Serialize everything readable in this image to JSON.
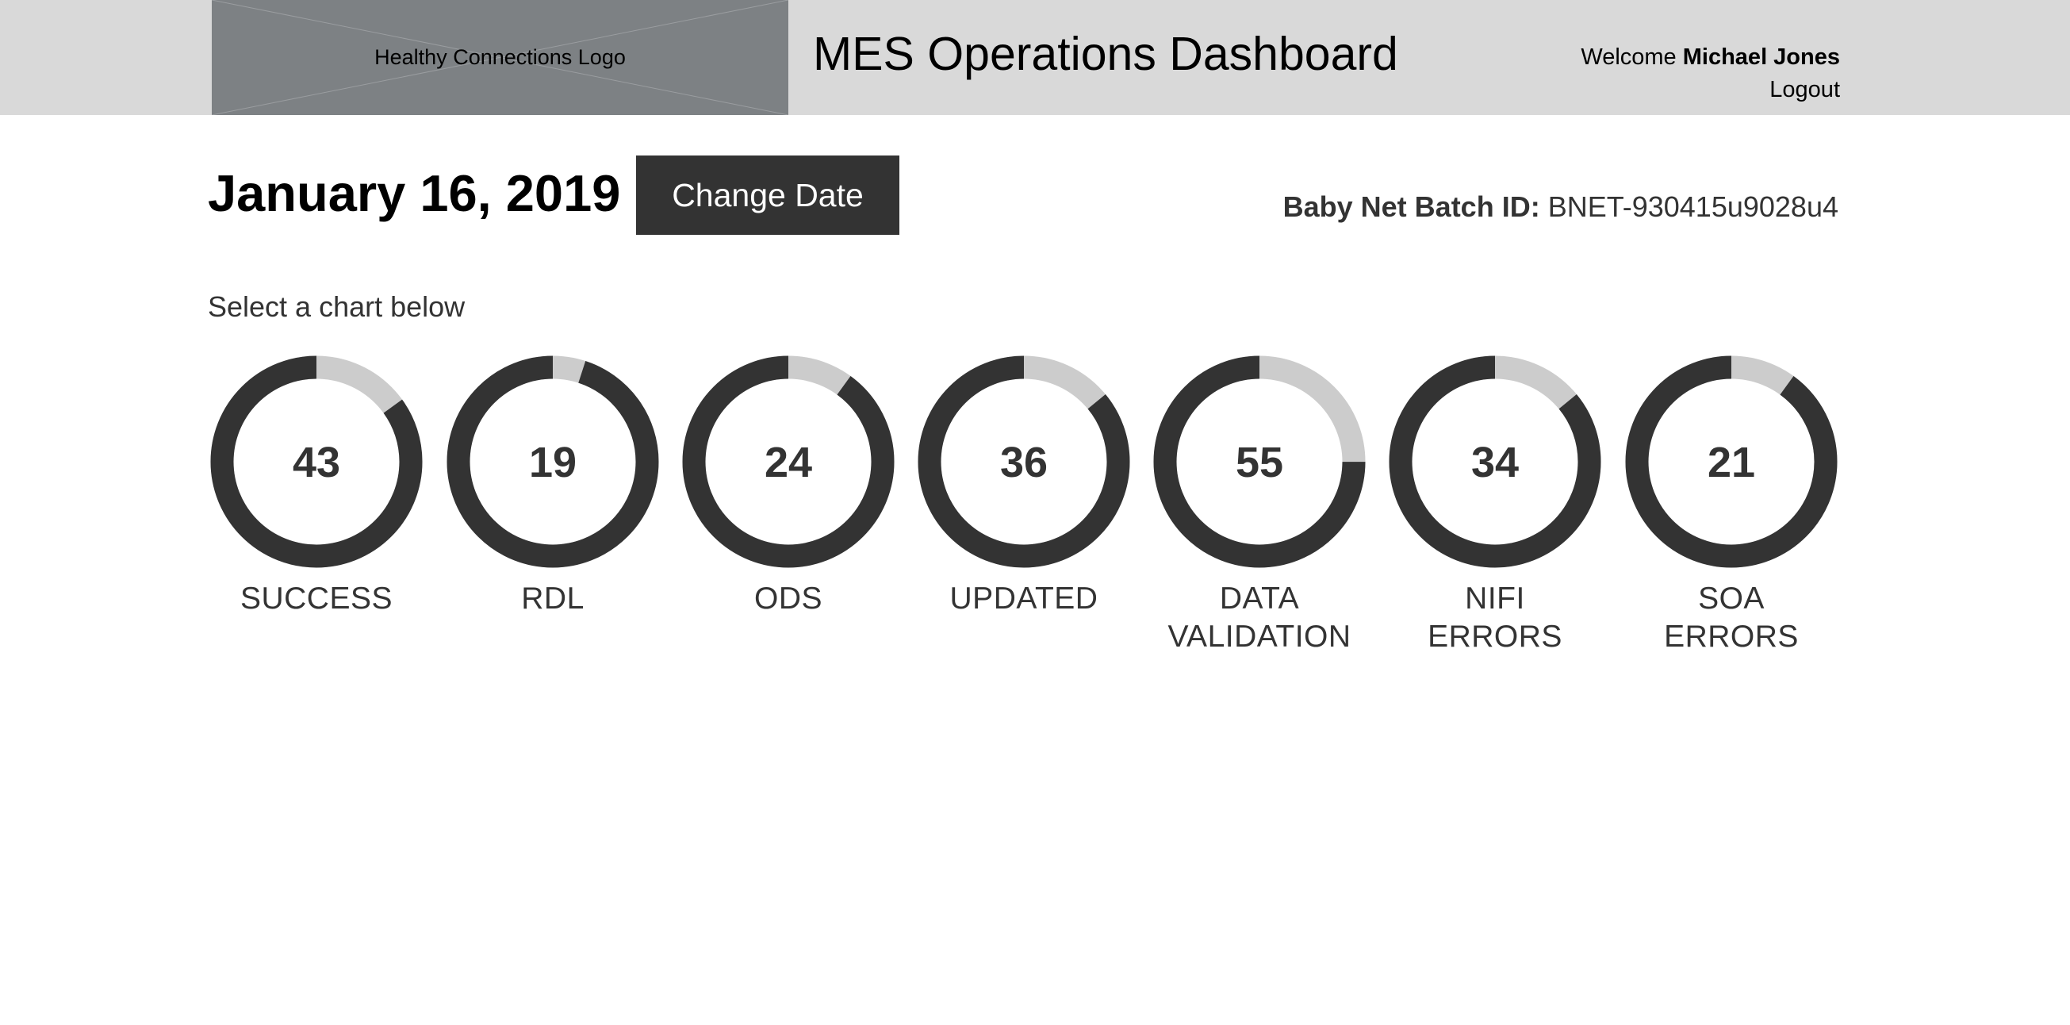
{
  "header": {
    "logo_text": "Healthy Connections Logo",
    "title": "MES Operations Dashboard",
    "welcome_prefix": "Welcome",
    "user_name": "Michael Jones",
    "logout_label": "Logout"
  },
  "toolbar": {
    "date": "January 16, 2019",
    "change_date_label": "Change Date",
    "batch_label": "Baby Net Batch ID:",
    "batch_id": "BNET-930415u9028u4"
  },
  "prompt": "Select a chart below",
  "colors": {
    "ring_fill": "#333333",
    "ring_track": "#cccccc",
    "header_bg": "#d9d9d9",
    "logo_bg": "#7d8184"
  },
  "chart_data": [
    {
      "type": "pie",
      "value": "43",
      "label_lines": [
        "SUCCESS"
      ],
      "remaining_fraction": 0.85
    },
    {
      "type": "pie",
      "value": "19",
      "label_lines": [
        "RDL"
      ],
      "remaining_fraction": 0.95
    },
    {
      "type": "pie",
      "value": "24",
      "label_lines": [
        "ODS"
      ],
      "remaining_fraction": 0.9
    },
    {
      "type": "pie",
      "value": "36",
      "label_lines": [
        "UPDATED"
      ],
      "remaining_fraction": 0.86
    },
    {
      "type": "pie",
      "value": "55",
      "label_lines": [
        "DATA",
        "VALIDATION"
      ],
      "remaining_fraction": 0.75
    },
    {
      "type": "pie",
      "value": "34",
      "label_lines": [
        "NIFI",
        "ERRORS"
      ],
      "remaining_fraction": 0.86
    },
    {
      "type": "pie",
      "value": "21",
      "label_lines": [
        "SOA",
        "ERRORS"
      ],
      "remaining_fraction": 0.9
    }
  ]
}
